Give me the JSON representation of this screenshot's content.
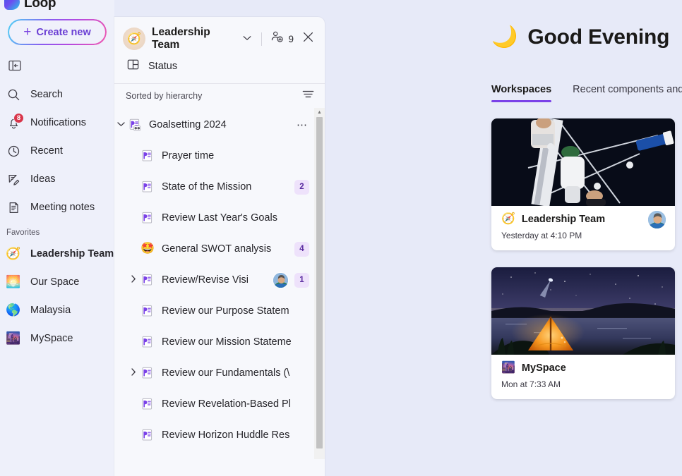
{
  "app": {
    "name": "Loop",
    "logo_icon": "loop-logo-icon"
  },
  "sidebar": {
    "create_new": {
      "label": "Create new",
      "plus_icon": "plus-icon"
    },
    "collapse_icon": "panel-collapse-icon",
    "items": [
      {
        "label": "Search",
        "icon": "search-icon",
        "badge": ""
      },
      {
        "label": "Notifications",
        "icon": "bell-icon",
        "badge": "8"
      },
      {
        "label": "Recent",
        "icon": "clock-icon",
        "badge": ""
      },
      {
        "label": "Ideas",
        "icon": "pencil-idea-icon",
        "badge": ""
      },
      {
        "label": "Meeting notes",
        "icon": "notes-icon",
        "badge": ""
      }
    ],
    "favorites_header": "Favorites",
    "favorites": [
      {
        "label": "Leadership Team",
        "emoji": "🧭",
        "bold": true
      },
      {
        "label": "Our Space",
        "emoji": "🌅",
        "bold": false
      },
      {
        "label": "Malaysia",
        "emoji": "🌎",
        "bold": false
      },
      {
        "label": "MySpace",
        "emoji": "🌆",
        "bold": false
      }
    ]
  },
  "panel": {
    "workspace_name": "Leadership Team",
    "workspace_emoji": "🧭",
    "chevron_icon": "chevron-down-icon",
    "members_icon": "add-people-icon",
    "members_count": "9",
    "close_icon": "close-icon",
    "status": {
      "label": "Status",
      "icon": "table-icon"
    },
    "sort_label": "Sorted by hierarchy",
    "sort_icon": "filter-sort-icon",
    "more_icon": "more-options-icon",
    "tree": [
      {
        "label": "Goalsetting 2024",
        "icon": "page-link-icon",
        "level": 0,
        "twisty": "expanded",
        "badge": "",
        "avatar": false,
        "more": true
      },
      {
        "label": "Prayer time",
        "icon": "page-icon",
        "level": 1,
        "twisty": "none",
        "badge": "",
        "avatar": false,
        "more": false
      },
      {
        "label": "State of the Mission",
        "icon": "page-icon",
        "level": 1,
        "twisty": "none",
        "badge": "2",
        "avatar": false,
        "more": false
      },
      {
        "label": "Review Last Year's Goals",
        "icon": "page-icon",
        "level": 1,
        "twisty": "none",
        "badge": "",
        "avatar": false,
        "more": false
      },
      {
        "label": "General SWOT analysis",
        "icon": "star-struck-emoji",
        "level": 1,
        "twisty": "none",
        "badge": "4",
        "avatar": false,
        "more": false
      },
      {
        "label": "Review/Revise Visi",
        "icon": "page-icon",
        "level": 1,
        "twisty": "collapsed",
        "badge": "1",
        "avatar": true,
        "more": false
      },
      {
        "label": "Review our Purpose Statem",
        "icon": "page-icon",
        "level": 1,
        "twisty": "none",
        "badge": "",
        "avatar": false,
        "more": false
      },
      {
        "label": "Review our Mission Stateme",
        "icon": "page-icon",
        "level": 1,
        "twisty": "none",
        "badge": "",
        "avatar": false,
        "more": false
      },
      {
        "label": "Review our Fundamentals (\\",
        "icon": "page-icon",
        "level": 1,
        "twisty": "collapsed",
        "badge": "",
        "avatar": false,
        "more": false
      },
      {
        "label": "Review Revelation-Based Pl",
        "icon": "page-icon",
        "level": 1,
        "twisty": "none",
        "badge": "",
        "avatar": false,
        "more": false
      },
      {
        "label": "Review Horizon Huddle Res",
        "icon": "page-icon",
        "level": 1,
        "twisty": "none",
        "badge": "",
        "avatar": false,
        "more": false
      }
    ],
    "scrollbar": {
      "up_arrow_icon": "scroll-up-arrow-icon"
    }
  },
  "main": {
    "greeting_text": "Good Evening",
    "greeting_emoji": "🌙",
    "tabs": [
      {
        "label": "Workspaces",
        "active": true
      },
      {
        "label": "Recent components and pa",
        "active": false
      }
    ],
    "cards": [
      {
        "title": "Leadership Team",
        "emoji": "🧭",
        "time": "Yesterday at 4:10 PM",
        "image": "rowing-photo",
        "has_avatar": true
      },
      {
        "title": "MySpace",
        "emoji": "🌆",
        "time": "Mon at 7:33 AM",
        "image": "night-camping-photo",
        "has_avatar": false
      }
    ]
  },
  "colors": {
    "accent_purple": "#7a41e8",
    "badge_red": "#d8354a",
    "badge_purple_bg": "#eee2fb",
    "page_bg": "#e7eaf8",
    "panel_bg": "#f7f8fc"
  }
}
